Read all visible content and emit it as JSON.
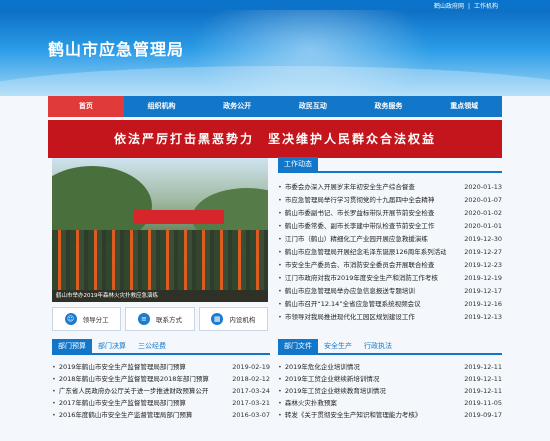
{
  "header": {
    "top_links": [
      "鹤山政府网",
      "工作机构"
    ],
    "site_title": "鹤山市应急管理局"
  },
  "nav": {
    "items": [
      "首页",
      "组织机构",
      "政务公开",
      "政民互动",
      "政务服务",
      "重点领域"
    ]
  },
  "slogan": "依法严厉打击黑恶势力　坚决维护人民群众合法权益",
  "photo": {
    "caption": "鹤山市举办2019年森林火灾扑救应急演练"
  },
  "quick_links": [
    {
      "label": "领导分工",
      "icon": "person-icon"
    },
    {
      "label": "联系方式",
      "icon": "document-icon"
    },
    {
      "label": "内设机构",
      "icon": "building-icon"
    }
  ],
  "work_news": {
    "tab": "工作动态",
    "items": [
      {
        "title": "市委会办深入开展岁末年初安全生产综合督查",
        "date": "2020-01-13"
      },
      {
        "title": "市应急管理局举行学习贯彻党的十九届四中全会精神",
        "date": "2020-01-07"
      },
      {
        "title": "鹤山市委副书记、市长罗益标带队开展节前安全检查",
        "date": "2020-01-02"
      },
      {
        "title": "鹤山市委常委、副市长李建中带队检查节前安全工作",
        "date": "2020-01-01"
      },
      {
        "title": "江门市（鹤山）精细化工产业园开展应急救援演练",
        "date": "2019-12-30"
      },
      {
        "title": "鹤山市应急管理局开展纪念毛泽东诞辰126周年系列活动",
        "date": "2019-12-27"
      },
      {
        "title": "市安全生产委员会、市消防安全委员会开展联合检查",
        "date": "2019-12-23"
      },
      {
        "title": "江门市政府对我市2019年度安全生产和消防工作考核",
        "date": "2019-12-19"
      },
      {
        "title": "鹤山市应急管理局举办应急信息报送专题培训",
        "date": "2019-12-17"
      },
      {
        "title": "鹤山市召开“12.14”全省应急管理系统视频会议",
        "date": "2019-12-16"
      },
      {
        "title": "市领导对我局推进现代化工园区规划建设工作",
        "date": "2019-12-13"
      }
    ]
  },
  "dept_budget": {
    "tabs": [
      "部门预算",
      "部门决算",
      "三公经费"
    ],
    "items": [
      {
        "title": "2019年鹤山市安全生产监督管理局部门预算",
        "date": "2019-02-19"
      },
      {
        "title": "2018年鹤山市安全生产监督管理局2018年部门预算",
        "date": "2018-02-12"
      },
      {
        "title": "广东省人民政府办公厅关于进一步推进财政预算公开",
        "date": "2017-03-24"
      },
      {
        "title": "2017年鹤山市安全生产监督管理局部门预算",
        "date": "2017-03-21"
      },
      {
        "title": "2016年度鹤山市安全生产监督管理局部门预算",
        "date": "2016-03-07"
      }
    ]
  },
  "dept_docs": {
    "tabs": [
      "部门文件",
      "安全生产",
      "行政执法"
    ],
    "items": [
      {
        "title": "2019年危化企业培训情况",
        "date": "2019-12-11"
      },
      {
        "title": "2019年工贸企业继续新培训情况",
        "date": "2019-12-11"
      },
      {
        "title": "2019年工贸企业继续教育培训情况",
        "date": "2019-12-11"
      },
      {
        "title": "森林火灾扑救预案",
        "date": "2019-11-05"
      },
      {
        "title": "转发《关于贯彻安全生产知识和管理能力考核》",
        "date": "2019-09-17"
      }
    ]
  }
}
